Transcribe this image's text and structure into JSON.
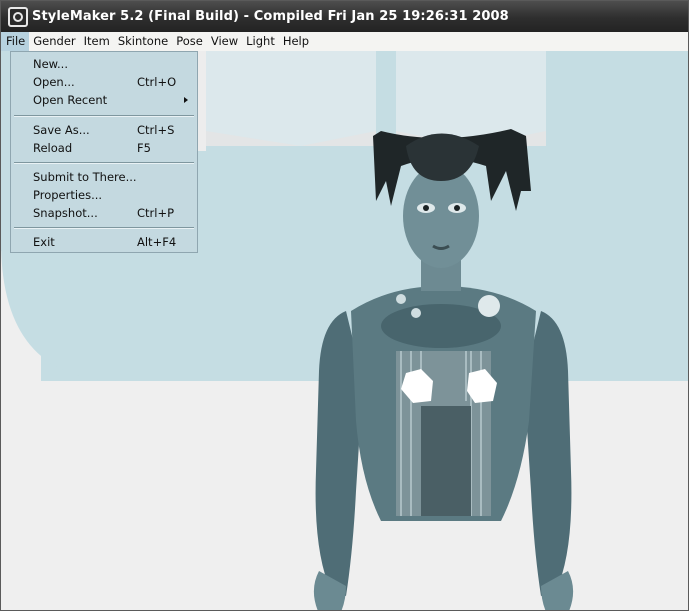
{
  "window": {
    "title": "StyleMaker 5.2 (Final Build) - Compiled Fri Jan 25 19:26:31 2008"
  },
  "menubar": {
    "items": [
      "File",
      "Gender",
      "Item",
      "Skintone",
      "Pose",
      "View",
      "Light",
      "Help"
    ],
    "active": "File"
  },
  "file_menu": {
    "items": [
      {
        "label": "New...",
        "shortcut": ""
      },
      {
        "label": "Open...",
        "shortcut": "Ctrl+O"
      },
      {
        "label": "Open Recent",
        "shortcut": "",
        "submenu": true
      },
      {
        "label": "Save As...",
        "shortcut": "Ctrl+S"
      },
      {
        "label": "Reload",
        "shortcut": "F5"
      },
      {
        "label": "Submit to There...",
        "shortcut": ""
      },
      {
        "label": "Properties...",
        "shortcut": ""
      },
      {
        "label": "Snapshot...",
        "shortcut": "Ctrl+P"
      },
      {
        "label": "Exit",
        "shortcut": "Alt+F4"
      }
    ]
  },
  "colors": {
    "titlebar": "#2e2e2e",
    "menu_highlight": "#b7d2df",
    "overlay_tint": "#c5dde3",
    "viewport_background": "#efefef"
  }
}
